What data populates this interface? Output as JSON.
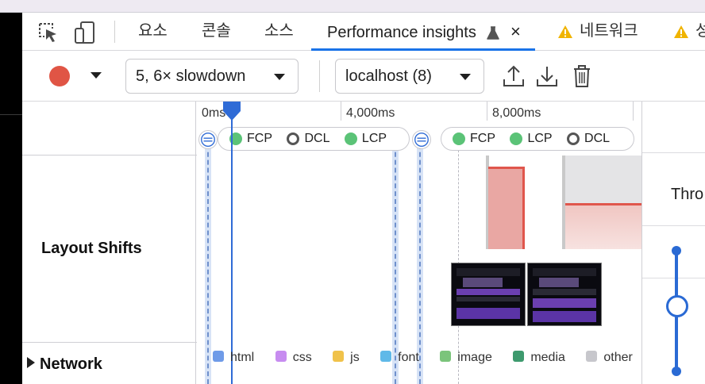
{
  "tabs": [
    {
      "label": "요소"
    },
    {
      "label": "콘솔"
    },
    {
      "label": "소스"
    },
    {
      "label": "Performance insights"
    },
    {
      "label": "네트워크"
    },
    {
      "label": "성"
    }
  ],
  "toolbar": {
    "throttle_select": "5, 6× slowdown",
    "page_select": "localhost (8)"
  },
  "timeline": {
    "ticks": [
      "0ms",
      "4,000ms",
      "8,000ms"
    ],
    "markers_group1": [
      "FCP",
      "DCL",
      "LCP"
    ],
    "markers_group2": [
      "FCP",
      "LCP",
      "DCL"
    ]
  },
  "rows": {
    "layout_shifts": "Layout Shifts",
    "network": "Network"
  },
  "legend": [
    {
      "label": "html",
      "color": "#6f9be8"
    },
    {
      "label": "css",
      "color": "#c78cf0"
    },
    {
      "label": "js",
      "color": "#f0c24a"
    },
    {
      "label": "font",
      "color": "#5fb9e8"
    },
    {
      "label": "image",
      "color": "#7bc47b"
    },
    {
      "label": "media",
      "color": "#3e9a6e"
    },
    {
      "label": "other",
      "color": "#c7c7cc"
    }
  ],
  "right_panel": {
    "throttling_label": "Thro"
  },
  "colors": {
    "accent": "#1a73e8",
    "record": "#e05545",
    "layout_shift": "#e0564c",
    "marker_green": "#5bc377",
    "warning": "#f0b400"
  }
}
